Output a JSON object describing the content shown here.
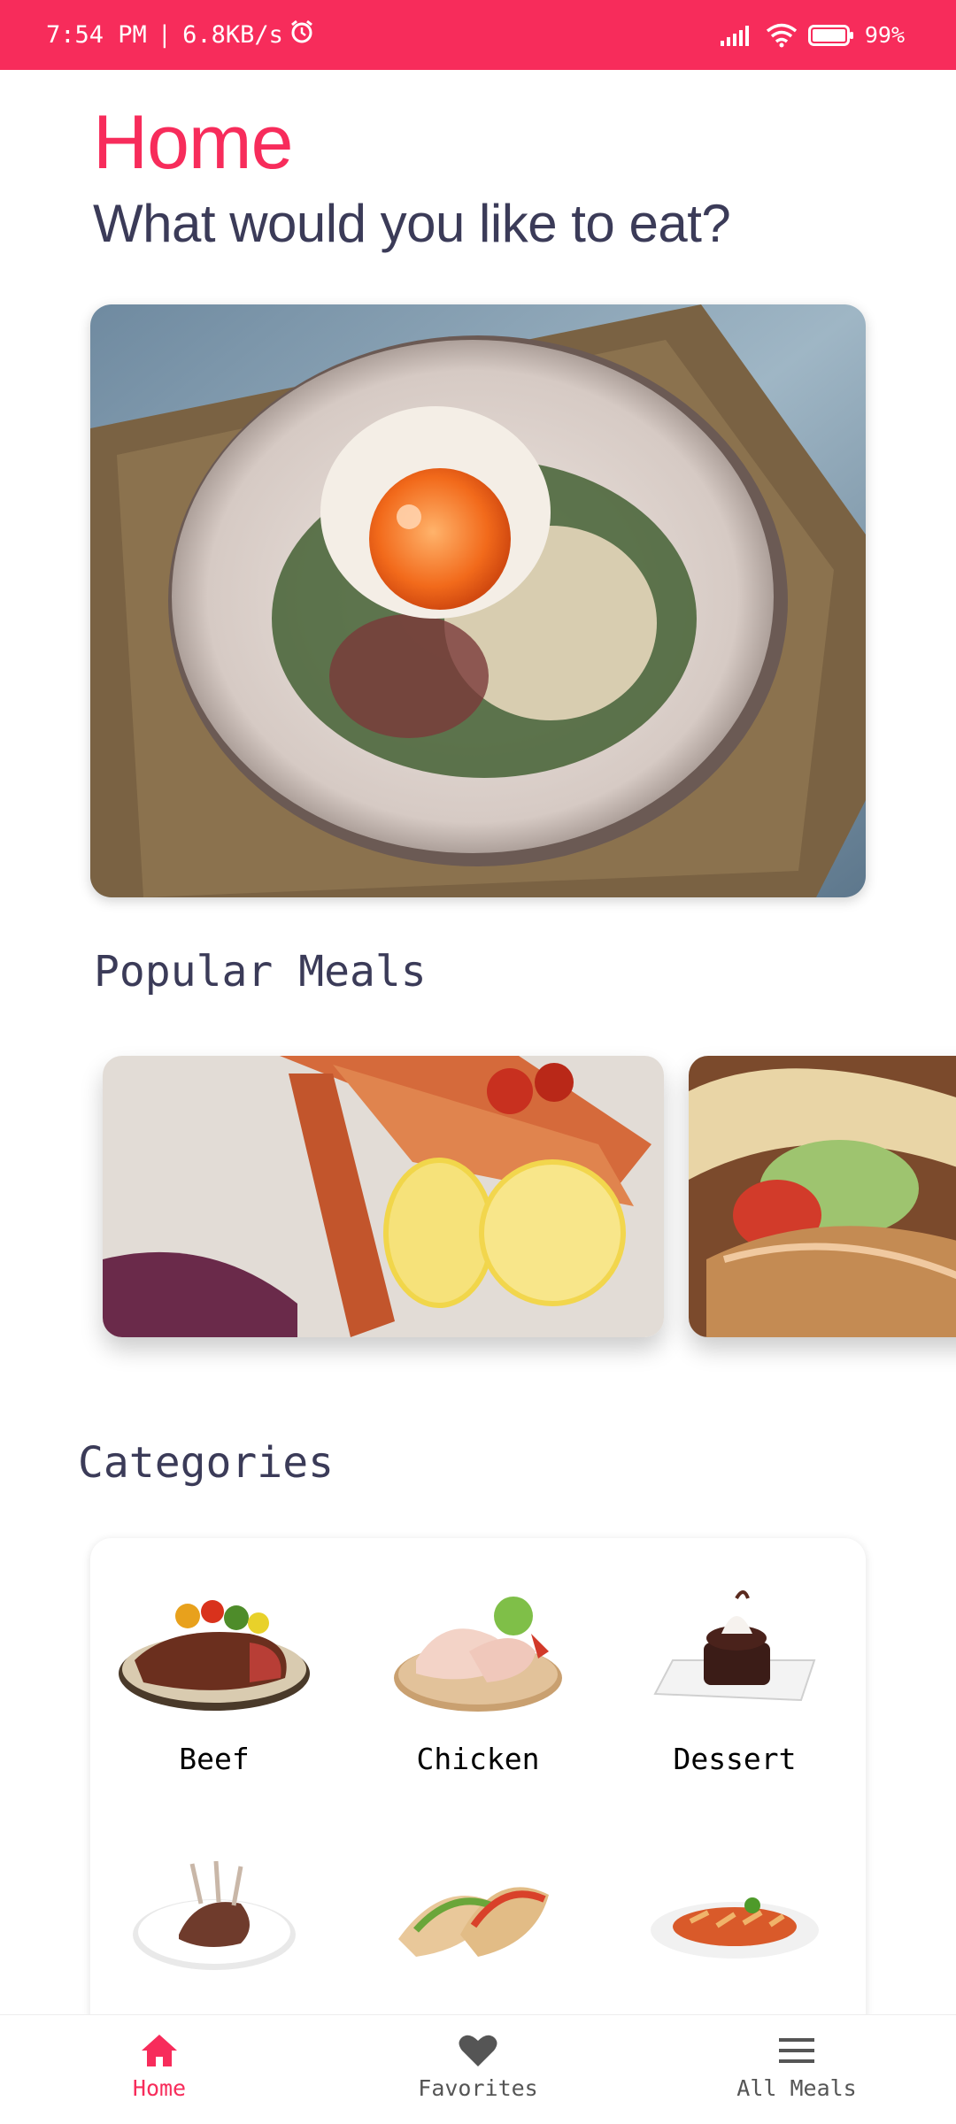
{
  "status_bar": {
    "time": "7:54 PM",
    "separator": "|",
    "network_speed": "6.8KB/s",
    "battery": "99"
  },
  "header": {
    "title": "Home",
    "subtitle": "What would you like to eat?"
  },
  "sections": {
    "popular": "Popular Meals",
    "categories": "Categories"
  },
  "popular_meals": [
    {
      "name": "salmon-with-lemon"
    },
    {
      "name": "tacos"
    }
  ],
  "categories": [
    {
      "label": "Beef",
      "icon": "beef-steak-icon"
    },
    {
      "label": "Chicken",
      "icon": "chicken-icon"
    },
    {
      "label": "Dessert",
      "icon": "dessert-icon"
    },
    {
      "label": "",
      "icon": "lamb-icon"
    },
    {
      "label": "",
      "icon": "tacos-icon"
    },
    {
      "label": "",
      "icon": "pasta-icon"
    }
  ],
  "bottom_nav": {
    "home": "Home",
    "favorites": "Favorites",
    "all_meals": "All Meals"
  },
  "colors": {
    "accent": "#f72c5b",
    "heading": "#3b3b58"
  }
}
